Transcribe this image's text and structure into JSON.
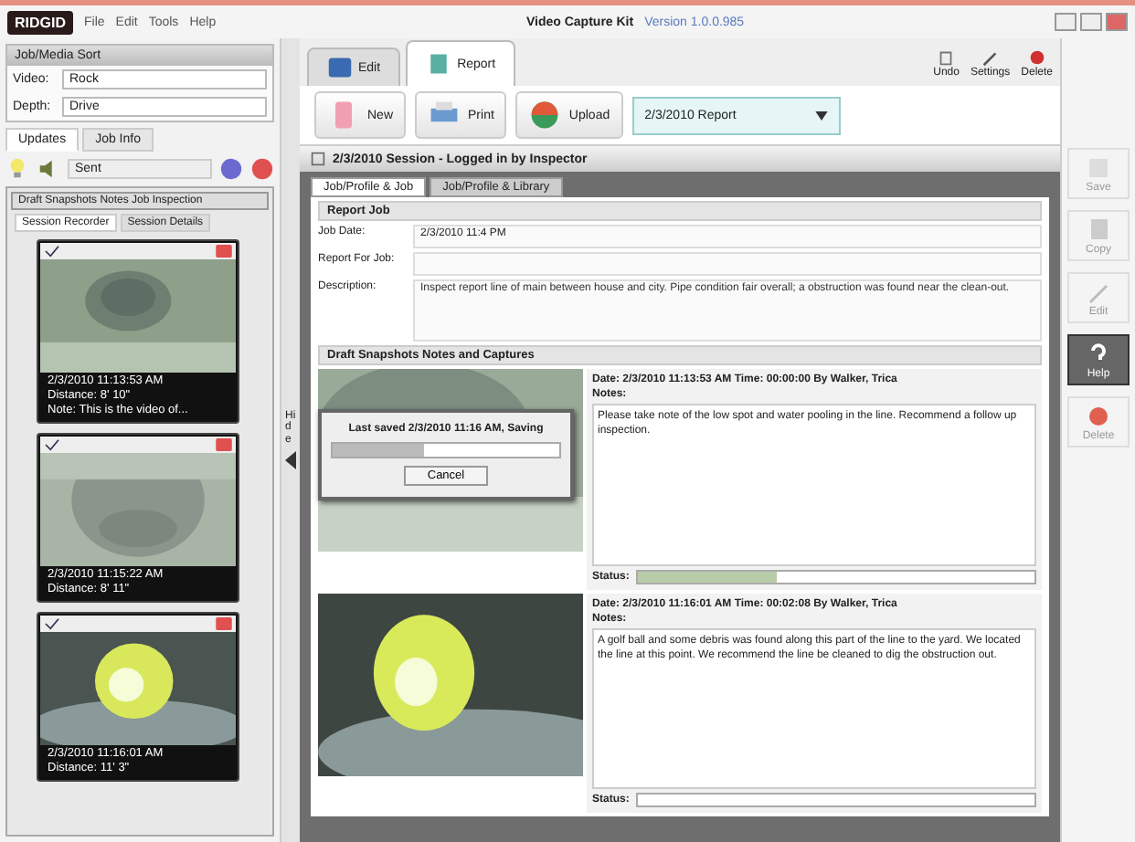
{
  "window": {
    "logo": "RIDGID",
    "menu": [
      "File",
      "Edit",
      "Tools",
      "Help"
    ],
    "title": "Video Capture Kit",
    "version": "Version 1.0.0.985"
  },
  "top_tools": [
    {
      "kind": "undo",
      "label": "Undo"
    },
    {
      "kind": "settings",
      "label": "Settings"
    },
    {
      "kind": "delete",
      "label": "Delete"
    }
  ],
  "sidebar": {
    "sort_title": "Job/Media Sort",
    "fields": [
      {
        "label": "Video:",
        "value": "Rock"
      },
      {
        "label": "Depth:",
        "value": "Drive"
      }
    ],
    "tabs": [
      {
        "label": "Updates",
        "selected": true
      },
      {
        "label": "Job Info",
        "selected": false
      }
    ],
    "filter": {
      "value": "Sent"
    },
    "panel_title": "Draft Snapshots Notes Job Inspection",
    "subtabs": [
      {
        "label": "Session Recorder",
        "selected": true
      },
      {
        "label": "Session Details",
        "selected": false
      }
    ],
    "thumbnails": [
      {
        "kind": "pipe",
        "lines": [
          "2/3/2010 11:13:53 AM",
          "Distance: 8' 10\"",
          "Note: This is the video of..."
        ]
      },
      {
        "kind": "bowl",
        "lines": [
          "2/3/2010 11:15:22 AM",
          "Distance: 8' 11\""
        ]
      },
      {
        "kind": "ball",
        "lines": [
          "2/3/2010 11:16:01 AM",
          "Distance: 11' 3\""
        ]
      }
    ]
  },
  "hide_label": "Hide",
  "main_tabs": [
    {
      "kind": "edit",
      "label": "Edit",
      "selected": false
    },
    {
      "kind": "report",
      "label": "Report",
      "selected": true
    }
  ],
  "toolbar": [
    {
      "kind": "new",
      "label": "New"
    },
    {
      "kind": "print",
      "label": "Print"
    },
    {
      "kind": "upload",
      "label": "Upload"
    }
  ],
  "report_select": {
    "value": "2/3/2010 Report"
  },
  "banner": "2/3/2010 Session - Logged in by Inspector",
  "report_tabs": [
    {
      "label": "Job/Profile & Job",
      "selected": true
    },
    {
      "label": "Job/Profile & Library",
      "selected": false
    }
  ],
  "report_section": "Report Job",
  "report_fields": [
    {
      "label": "Job Date:",
      "value": "2/3/2010 11:4 PM"
    },
    {
      "label": "Report For Job:"
    },
    {
      "label": "Description:",
      "value": "Inspect report line of main between house and city. Pipe condition fair overall; a obstruction was found near the clean-out."
    }
  ],
  "captures_section": "Draft Snapshots Notes and Captures",
  "captures": [
    {
      "kind": "pipe",
      "header": "Date: 2/3/2010 11:13:53 AM  Time: 00:00:00  By Walker, Trica",
      "notes_label": "Notes:",
      "notes": "Please take note of the low spot and water pooling in the line. Recommend a follow up inspection.",
      "status_label": "Status:",
      "level": 0.35
    },
    {
      "kind": "ball",
      "header": "Date: 2/3/2010 11:16:01 AM  Time: 00:02:08  By Walker, Trica",
      "notes_label": "Notes:",
      "notes": "A golf ball and some debris was found along this part of the line to the yard. We located the line at this point. We recommend the line be cleaned to dig the obstruction out.",
      "status_label": "Status:"
    }
  ],
  "dialog": {
    "message": "Last saved 2/3/2010 11:16 AM, Saving",
    "level": 0.4,
    "button": "Cancel"
  },
  "side_tools": [
    {
      "kind": "save",
      "label": "Save",
      "selected": false
    },
    {
      "kind": "copy",
      "label": "Copy",
      "selected": false
    },
    {
      "kind": "edit",
      "label": "Edit",
      "selected": false
    },
    {
      "kind": "help",
      "label": "Help",
      "selected": true
    },
    {
      "kind": "delete",
      "label": "Delete",
      "selected": false
    }
  ]
}
